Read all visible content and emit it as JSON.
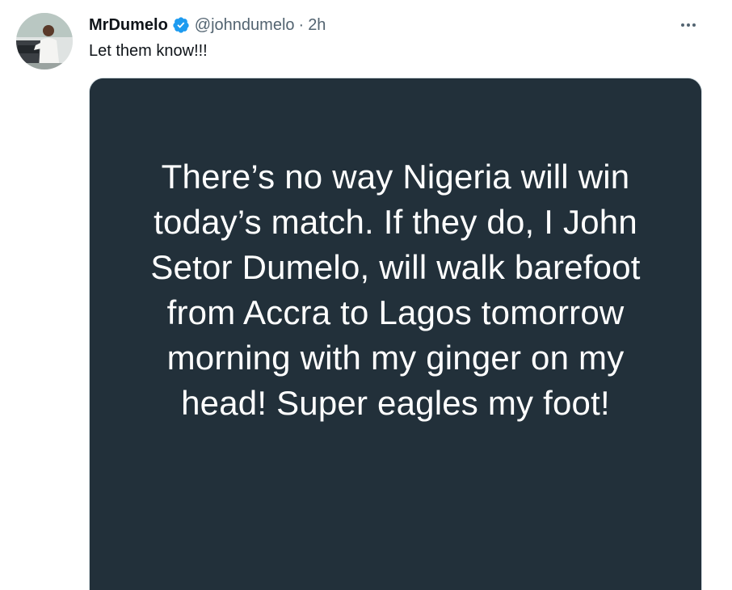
{
  "tweet": {
    "author": {
      "display_name": "MrDumelo",
      "handle": "@johndumelo",
      "verified": true,
      "verified_icon": "verified-badge-icon"
    },
    "separator": "·",
    "time": "2h",
    "text": "Let them know!!!",
    "more_icon": "more-horizontal-icon",
    "media": {
      "image_text": "There’s no way Nigeria will win today’s match. If they do, I John Setor Dumelo, will walk barefoot from Accra to Lagos tomorrow morning with my ginger on my head! Super eagles my foot!",
      "background": "#22303a"
    }
  },
  "colors": {
    "verified_blue": "#1d9bf0",
    "secondary_text": "#536471",
    "primary_text": "#0f1419"
  }
}
